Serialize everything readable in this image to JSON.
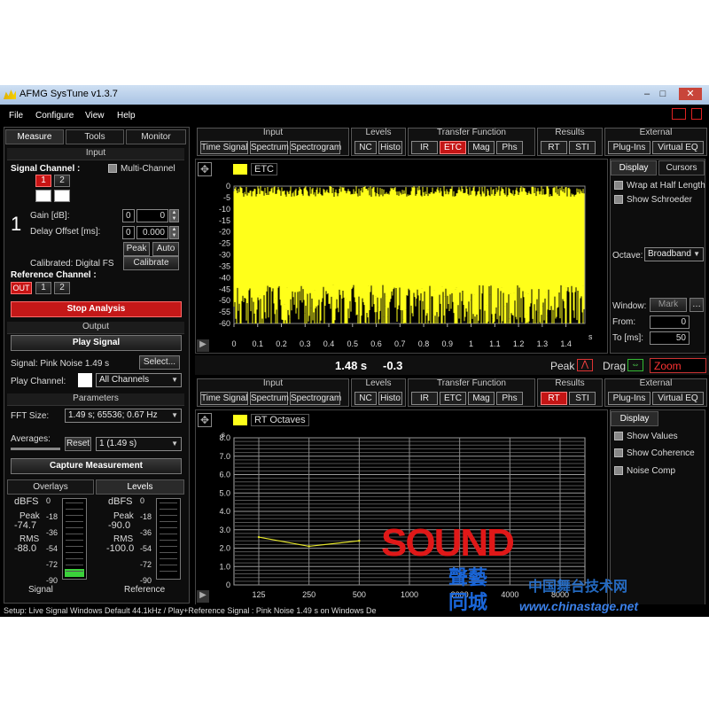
{
  "window": {
    "title": "AFMG SysTune v1.3.7"
  },
  "menu": [
    "File",
    "Configure",
    "View",
    "Help"
  ],
  "left_tabs": [
    "Measure",
    "Tools",
    "Monitor"
  ],
  "input": {
    "header": "Input",
    "signal_channel": "Signal Channel :",
    "multi_channel": "Multi-Channel",
    "ch1": "1",
    "ch2": "2",
    "channel_index": "1",
    "gain_label": "Gain [dB]:",
    "delay_label": "Delay Offset [ms]:",
    "gain_a": "0",
    "gain_b": "0",
    "delay_a": "0",
    "delay_b": "0.000",
    "peak": "Peak",
    "auto": "Auto",
    "calibrated": "Calibrated: Digital FS",
    "calibrate": "Calibrate",
    "reference_channel": "Reference Channel :",
    "ref_out": "OUT",
    "ref1": "1",
    "ref2": "2"
  },
  "stop_analysis": "Stop Analysis",
  "output": {
    "header": "Output",
    "play_signal": "Play Signal",
    "signal_text": "Signal: Pink Noise  1.49 s",
    "select": "Select...",
    "play_channel_label": "Play Channel:",
    "play_channel_value": "All Channels"
  },
  "parameters": {
    "header": "Parameters",
    "fft_size_label": "FFT Size:",
    "fft_size_value": "1.49 s; 65536; 0.67 Hz",
    "averages_label": "Averages:",
    "reset": "Reset",
    "averages_value": "1 (1.49 s)",
    "capture": "Capture Measurement"
  },
  "bottom_tabs": [
    "Overlays",
    "Levels"
  ],
  "levels": {
    "signal": {
      "unit": "dBFS",
      "peak_label": "Peak",
      "peak": "-74.7",
      "rms_label": "RMS",
      "rms": "-88.0",
      "name": "Signal",
      "fill": 0.1
    },
    "reference": {
      "unit": "dBFS",
      "peak_label": "Peak",
      "peak": "-90.0",
      "rms_label": "RMS",
      "rms": "-100.0",
      "name": "Reference",
      "fill": 0
    },
    "scale": [
      "0",
      "-18",
      "-36",
      "-54",
      "-72",
      "-90"
    ]
  },
  "toolbar_top": {
    "groups": [
      {
        "label": "Input",
        "buttons": [
          "Time Signal",
          "Spectrum",
          "Spectrogram"
        ]
      },
      {
        "label": "Levels",
        "buttons": [
          "NC",
          "Histo"
        ]
      },
      {
        "label": "Transfer Function",
        "buttons": [
          "IR",
          "ETC",
          "Mag",
          "Phs"
        ],
        "active": "ETC"
      },
      {
        "label": "Results",
        "buttons": [
          "RT",
          "STI"
        ]
      },
      {
        "label": "External",
        "buttons": [
          "Plug-Ins",
          "Virtual EQ"
        ]
      }
    ]
  },
  "toolbar_bottom": {
    "groups": [
      {
        "label": "Input",
        "buttons": [
          "Time Signal",
          "Spectrum",
          "Spectrogram"
        ]
      },
      {
        "label": "Levels",
        "buttons": [
          "NC",
          "Histo"
        ]
      },
      {
        "label": "Transfer Function",
        "buttons": [
          "IR",
          "ETC",
          "Mag",
          "Phs"
        ]
      },
      {
        "label": "Results",
        "buttons": [
          "RT",
          "STI"
        ],
        "active": "RT"
      },
      {
        "label": "External",
        "buttons": [
          "Plug-Ins",
          "Virtual EQ"
        ]
      }
    ]
  },
  "etc_panel": {
    "legend": "ETC",
    "y_ticks": [
      "0",
      "-5",
      "-10",
      "-15",
      "-20",
      "-25",
      "-30",
      "-35",
      "-40",
      "-45",
      "-50",
      "-55",
      "-60"
    ],
    "x_ticks": [
      "0",
      "0.1",
      "0.2",
      "0.3",
      "0.4",
      "0.5",
      "0.6",
      "0.7",
      "0.8",
      "0.9",
      "1",
      "1.1",
      "1.2",
      "1.3",
      "1.4"
    ],
    "x_unit": "s",
    "cursor_time": "1.48 s",
    "cursor_level": "-0.3",
    "peak": "Peak",
    "drag": "Drag",
    "zoom": "Zoom"
  },
  "etc_side": {
    "tabs": [
      "Display",
      "Cursors"
    ],
    "wrap": "Wrap at Half Length",
    "schroeder": "Show Schroeder",
    "octave_label": "Octave:",
    "octave_value": "Broadband",
    "window_label": "Window:",
    "mark": "Mark",
    "from_label": "From:",
    "from_value": "0",
    "to_label": "To [ms]:",
    "to_value": "50"
  },
  "rt_panel": {
    "legend": "RT Octaves",
    "y_unit": "s",
    "y_ticks": [
      "8.0",
      "7.0",
      "6.0",
      "5.0",
      "4.0",
      "3.0",
      "2.0",
      "1.0",
      "0"
    ],
    "x_ticks": [
      "125",
      "250",
      "500",
      "1000",
      "2000",
      "4000",
      "8000"
    ]
  },
  "rt_side": {
    "tab": "Display",
    "show_values": "Show Values",
    "show_coherence": "Show Coherence",
    "noise_comp": "Noise Comp"
  },
  "chart_data": {
    "type": "line",
    "title": "RT Octaves",
    "x": [
      "125",
      "250",
      "500",
      "1000",
      "2000",
      "4000",
      "8000"
    ],
    "ylabel": "s",
    "ylim": [
      0,
      8
    ],
    "series": [
      {
        "name": "RT Octaves",
        "values": [
          2.6,
          2.1,
          2.4,
          null,
          null,
          null,
          null
        ]
      }
    ]
  },
  "status": "Setup: Live Signal Windows Default 44.1kHz / Play+Reference Signal : Pink Noise  1.49 s on Windows De",
  "watermark": {
    "sound": "SOUND",
    "cn1": "聲藝",
    "cn2": "同城",
    "site_cn": "中国舞台技术网",
    "url": "www.chinastage.net"
  },
  "colors": {
    "accent_red": "#c41818",
    "etc_yellow": "#ffff1a",
    "meter_green": "#3bd13b"
  }
}
